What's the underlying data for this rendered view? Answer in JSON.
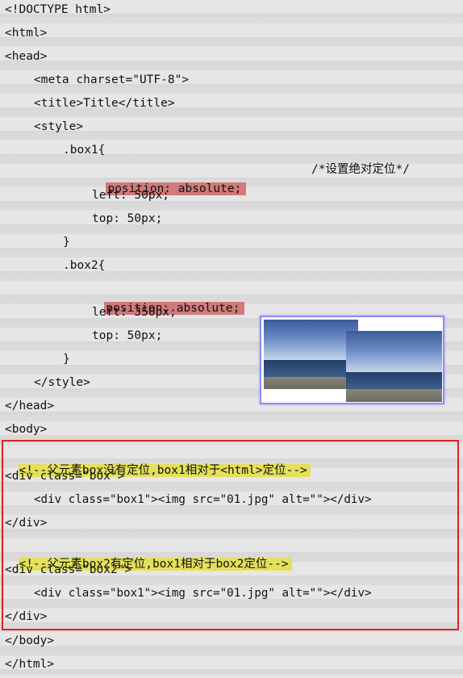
{
  "code": {
    "l1": "<!DOCTYPE html>",
    "l2": "<html>",
    "l3": "<head>",
    "l4": "<meta charset=\"UTF-8\">",
    "l5": "<title>Title</title>",
    "l6": "<style>",
    "l7": ".box1{",
    "l8_decl": "position: absolute;",
    "l8_comment": "/*设置绝对定位*/",
    "l9": "left: 50px;",
    "l10": "top: 50px;",
    "l11": "}",
    "l12": ".box2{",
    "l13_decl": "position: absolute;",
    "l14": "left: 350px;",
    "l15": "top: 50px;",
    "l16": "}",
    "l17": "</style>",
    "l18": "</head>",
    "l19": "<body>",
    "l20_comment": "<!--父元素box没有定位,box1相对于<html>定位-->",
    "l21": "<div class=\"box\">",
    "l22": "<div class=\"box1\"><img src=\"01.jpg\" alt=\"\"></div>",
    "l23": "</div>",
    "l24_comment": "<!--父元素box2有定位,box1相对于box2定位-->",
    "l25": "<div class=\"box2\">",
    "l26": "<div class=\"box1\"><img src=\"01.jpg\" alt=\"\"></div>",
    "l27": "</div>",
    "l28": "</body>",
    "l29": "</html>"
  },
  "colors": {
    "highlight_red": "#d07a7a",
    "highlight_yellow": "#e4e05a",
    "frame_red": "#e02020"
  }
}
